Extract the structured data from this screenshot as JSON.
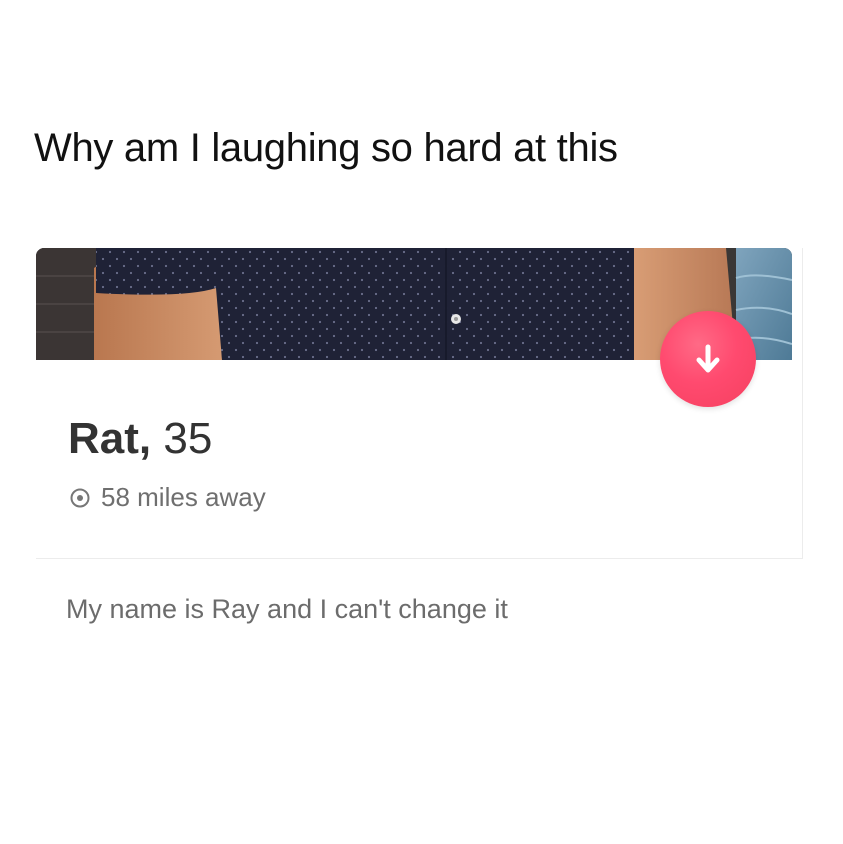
{
  "caption": "Why am I laughing so hard at this",
  "profile": {
    "name": "Rat,",
    "age": "35",
    "distance": "58 miles away",
    "bio": "My name is Ray and I can't change it"
  },
  "icons": {
    "rewind": "arrow-down-icon",
    "location": "location-pin-icon"
  },
  "colors": {
    "accent": "#ff4a6f",
    "shirt": "#1f2236",
    "skin": "#c88a66"
  }
}
